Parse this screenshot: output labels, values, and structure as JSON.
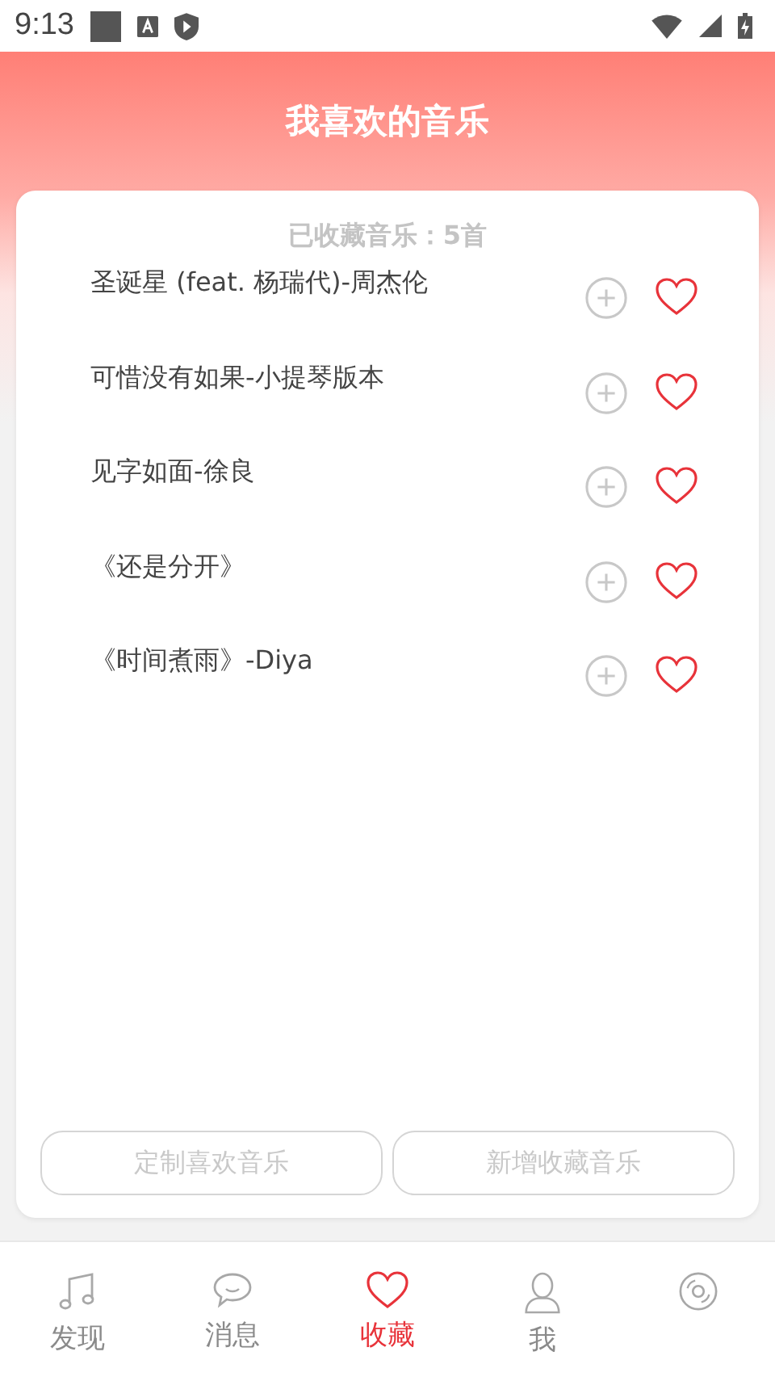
{
  "status_bar": {
    "time": "9:13"
  },
  "header": {
    "title": "我喜欢的音乐"
  },
  "summary": "已收藏音乐：5首",
  "songs": [
    {
      "title": "圣诞星 (feat. 杨瑞代)-周杰伦",
      "liked": true
    },
    {
      "title": "可惜没有如果-小提琴版本",
      "liked": true
    },
    {
      "title": "见字如面-徐良",
      "liked": true
    },
    {
      "title": "《还是分开》",
      "liked": true
    },
    {
      "title": "《时间煮雨》-Diya",
      "liked": true
    }
  ],
  "buttons": [
    "定制喜欢音乐",
    "新增收藏音乐"
  ],
  "nav": [
    {
      "kind": "note",
      "label": "发现",
      "selected": false
    },
    {
      "kind": "chat",
      "label": "消息",
      "selected": false
    },
    {
      "kind": "heart",
      "label": "收藏",
      "selected": true
    },
    {
      "kind": "person",
      "label": "我",
      "selected": false
    },
    {
      "kind": "disc",
      "selected": false
    }
  ]
}
